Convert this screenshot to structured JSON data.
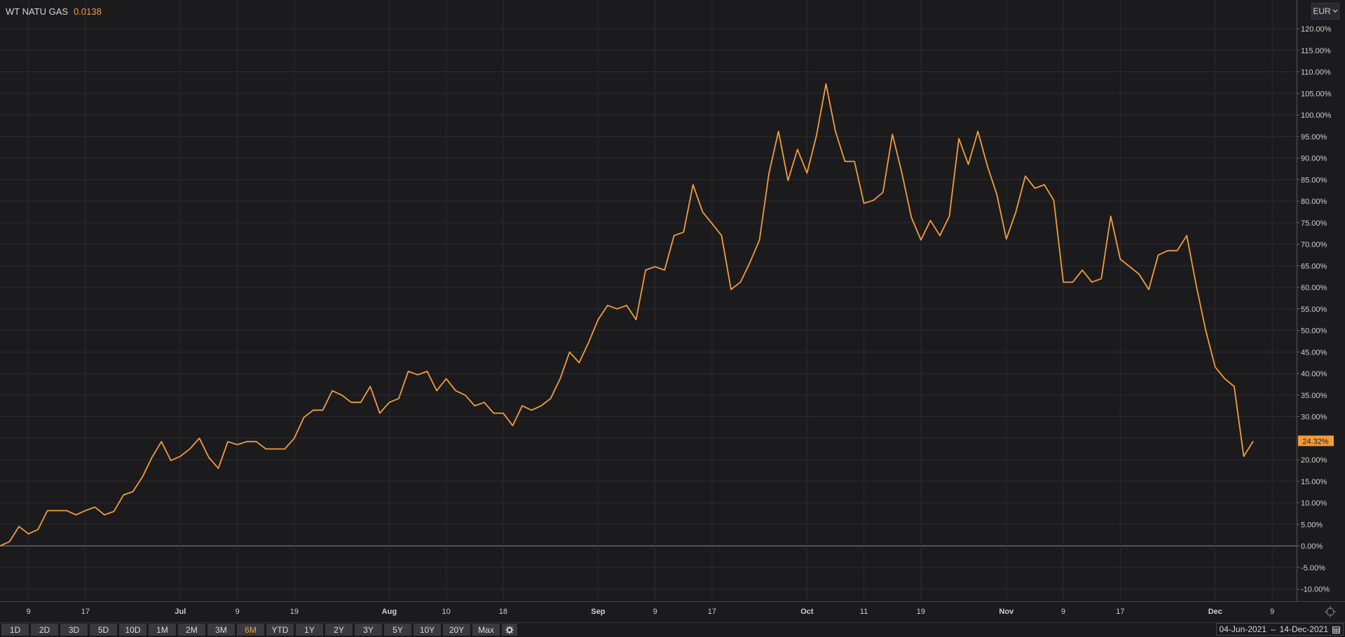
{
  "header": {
    "instrument": "WT NATU GAS",
    "value": "0.0138"
  },
  "currency": {
    "label": "EUR",
    "icon": "chevron-down-icon"
  },
  "current_label": "24.32%",
  "range_buttons": [
    "1D",
    "2D",
    "3D",
    "5D",
    "10D",
    "1M",
    "2M",
    "3M",
    "6M",
    "YTD",
    "1Y",
    "2Y",
    "3Y",
    "5Y",
    "10Y",
    "20Y",
    "Max"
  ],
  "active_range": "6M",
  "date_range": {
    "start": "04-Jun-2021",
    "sep": "–",
    "end": "14-Dec-2021"
  },
  "colors": {
    "line": "#f39c3a",
    "background": "#1b1b1e",
    "grid": "#2c2c30",
    "zero_line": "#8a8a8a"
  },
  "chart_data": {
    "type": "line",
    "series": [
      {
        "values": [
          0.0,
          1.0,
          4.5,
          2.8,
          3.8,
          8.2,
          8.2,
          8.2,
          7.2,
          8.2,
          9.0,
          7.2,
          8.0,
          11.8,
          12.6,
          16.0,
          20.5,
          24.2,
          19.8,
          20.8,
          22.5,
          25.0,
          20.5,
          18.0,
          24.2,
          23.5,
          24.2,
          24.2,
          22.5,
          22.5,
          22.5,
          25.0,
          29.8,
          31.5,
          31.5,
          36.0,
          35.0,
          33.3,
          33.3,
          37.0,
          30.8,
          33.3,
          34.2,
          40.5,
          39.7,
          40.5,
          36.0,
          38.8,
          36.0,
          35.0,
          32.5,
          33.3,
          30.8,
          30.8,
          27.9,
          32.5,
          31.5,
          32.5,
          34.2,
          38.8,
          45.0,
          42.5,
          47.2,
          52.5,
          55.8,
          55.0,
          55.8,
          52.5,
          64.0,
          64.8,
          64.0,
          72.0,
          72.8,
          83.8,
          77.5,
          74.8,
          72.0,
          59.5,
          61.2,
          65.8,
          71.0,
          86.5,
          96.2,
          84.8,
          92.0,
          86.5,
          95.2,
          107.2,
          96.2,
          89.2,
          89.2,
          79.5,
          80.2,
          82.0,
          95.5,
          86.5,
          76.2,
          71.0,
          75.5,
          72.0,
          76.5,
          94.5,
          88.5,
          96.2,
          88.2,
          81.5,
          71.2,
          77.5,
          85.8,
          83.0,
          83.8,
          80.2,
          61.2,
          61.2,
          64.0,
          61.2,
          62.0,
          76.5,
          66.5,
          64.8,
          63.0,
          59.5,
          67.5,
          68.5,
          68.5,
          72.0,
          60.5,
          50.0,
          41.5,
          38.8,
          37.0,
          20.8,
          24.3
        ]
      }
    ],
    "ylim": [
      -12,
      124
    ],
    "y_ticks": [
      "120.00%",
      "115.00%",
      "110.00%",
      "105.00%",
      "100.00%",
      "95.00%",
      "90.00%",
      "85.00%",
      "80.00%",
      "75.00%",
      "70.00%",
      "65.00%",
      "60.00%",
      "55.00%",
      "50.00%",
      "45.00%",
      "40.00%",
      "35.00%",
      "30.00%",
      "25.00%",
      "20.00%",
      "15.00%",
      "10.00%",
      "5.00%",
      "0.00%",
      "-5.00%",
      "-10.00%"
    ],
    "x_ticks": [
      "9",
      "17",
      "Jul",
      "9",
      "19",
      "Aug",
      "10",
      "18",
      "Sep",
      "9",
      "17",
      "Oct",
      "11",
      "19",
      "Nov",
      "9",
      "17",
      "Dec",
      "9"
    ],
    "x_tick_bold": [
      false,
      false,
      true,
      false,
      false,
      true,
      false,
      false,
      true,
      false,
      false,
      true,
      false,
      false,
      true,
      false,
      false,
      true,
      false
    ],
    "grid": true
  }
}
